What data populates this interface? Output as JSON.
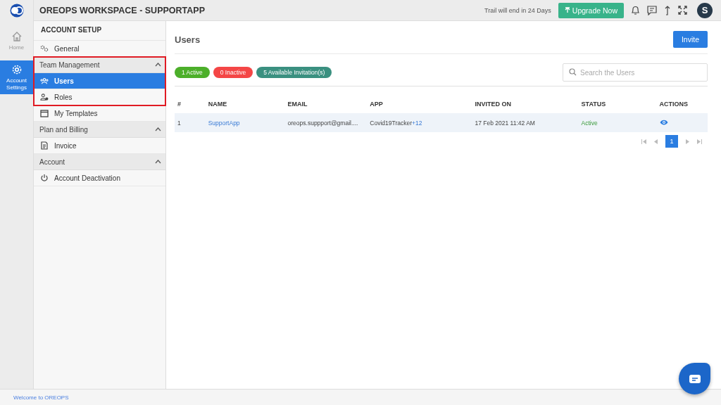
{
  "app": {
    "title": "OREOPS WORKSPACE - SUPPORTAPP",
    "trial_notice": "Trail will end in 24 Days",
    "upgrade_button": "Upgrade Now",
    "avatar": "S"
  },
  "rail": [
    {
      "label": "Home",
      "selected": false
    },
    {
      "label": "Account Settings",
      "selected": true
    }
  ],
  "settings_nav": {
    "heading": "ACCOUNT SETUP",
    "items": [
      {
        "kind": "item",
        "label": "General",
        "selected": false
      },
      {
        "kind": "group",
        "label": "Team Management",
        "expanded": true,
        "highlighted": true,
        "children": [
          {
            "label": "Users",
            "selected": true
          },
          {
            "label": "Roles",
            "selected": false
          }
        ]
      },
      {
        "kind": "item",
        "label": "My Templates",
        "selected": false
      },
      {
        "kind": "group",
        "label": "Plan and Billing",
        "expanded": true,
        "children": [
          {
            "label": "Invoice",
            "selected": false
          }
        ]
      },
      {
        "kind": "group",
        "label": "Account",
        "expanded": true,
        "children": [
          {
            "label": "Account Deactivation",
            "selected": false
          }
        ]
      }
    ]
  },
  "main": {
    "title": "Users",
    "invite_button": "Invite",
    "badges": [
      {
        "label": "1 Active",
        "color": "#4caf2a"
      },
      {
        "label": "0 Inactive",
        "color": "#f44646"
      },
      {
        "label": "5 Available Invitation(s)",
        "color": "#3a9080"
      }
    ],
    "search": {
      "placeholder": "Search the Users"
    },
    "table": {
      "columns": [
        "#",
        "NAME",
        "EMAIL",
        "APP",
        "INVITED ON",
        "STATUS",
        "ACTIONS"
      ],
      "rows": [
        {
          "index": "1",
          "name": "SupportApp",
          "email": "oreops.suppport@gmail....",
          "app": "Covid19Tracker",
          "app_extra": "+12",
          "invited_on": "17 Feb 2021 11:42 AM",
          "status": "Active"
        }
      ]
    },
    "pagination": [
      {
        "label": "1",
        "selected": true
      }
    ]
  },
  "footer": "Welcome to OREOPS"
}
